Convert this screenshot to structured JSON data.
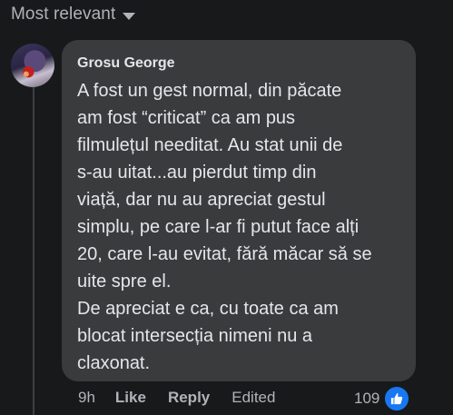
{
  "sort": {
    "label": "Most relevant"
  },
  "comment": {
    "author": "Grosu George",
    "text": "A fost un gest normal, din păcate\nam fost “criticat” ca am pus\nfilmulețul needitat. Au stat unii de\ns-au uitat...au pierdut timp din\nviață, dar nu au apreciat gestul\nsimplu, pe care l-ar fi putut face alți\n20, care l-au evitat, fără măcar să se\nuite spre el.\nDe apreciat e ca, cu toate ca am\nblocat intersecția nimeni nu a\nclaxonat.",
    "time": "9h",
    "like_label": "Like",
    "reply_label": "Reply",
    "edited_label": "Edited",
    "reaction_count": "109",
    "reaction_icon": "like-thumb-icon"
  },
  "colors": {
    "background": "#18191a",
    "bubble": "#3a3b3c",
    "text": "#e4e6eb",
    "secondary_text": "#b0b3b8",
    "like_blue": "#1877f2"
  }
}
